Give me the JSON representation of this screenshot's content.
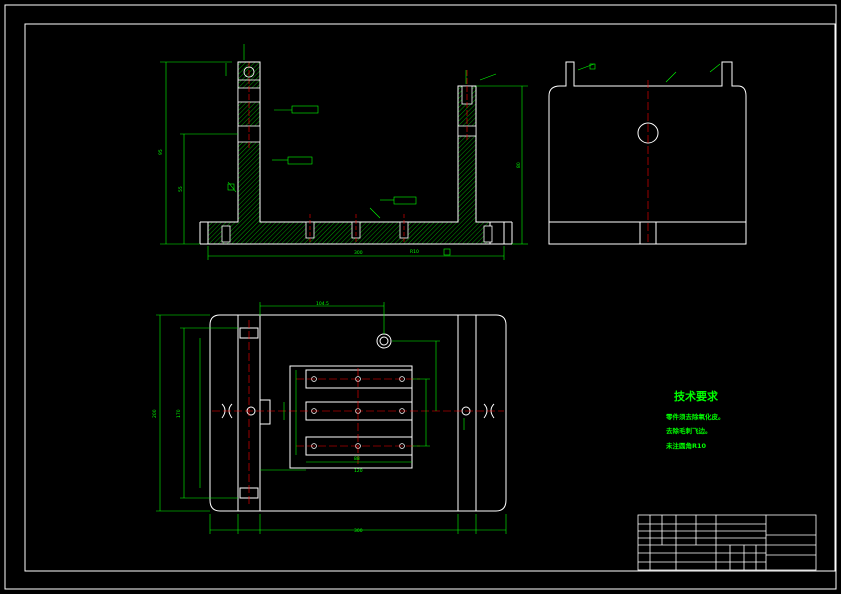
{
  "drawing": {
    "technical_requirements": {
      "title": "技术要求",
      "lines": [
        "零件须去除氧化皮。",
        "去除毛刺飞边。",
        "未注圆角R10"
      ]
    },
    "dimensions": {
      "front_total_width": "300",
      "front_overall_height": "95",
      "front_inner_height": "80",
      "plan_width": "300",
      "plan_depth": "200"
    }
  }
}
